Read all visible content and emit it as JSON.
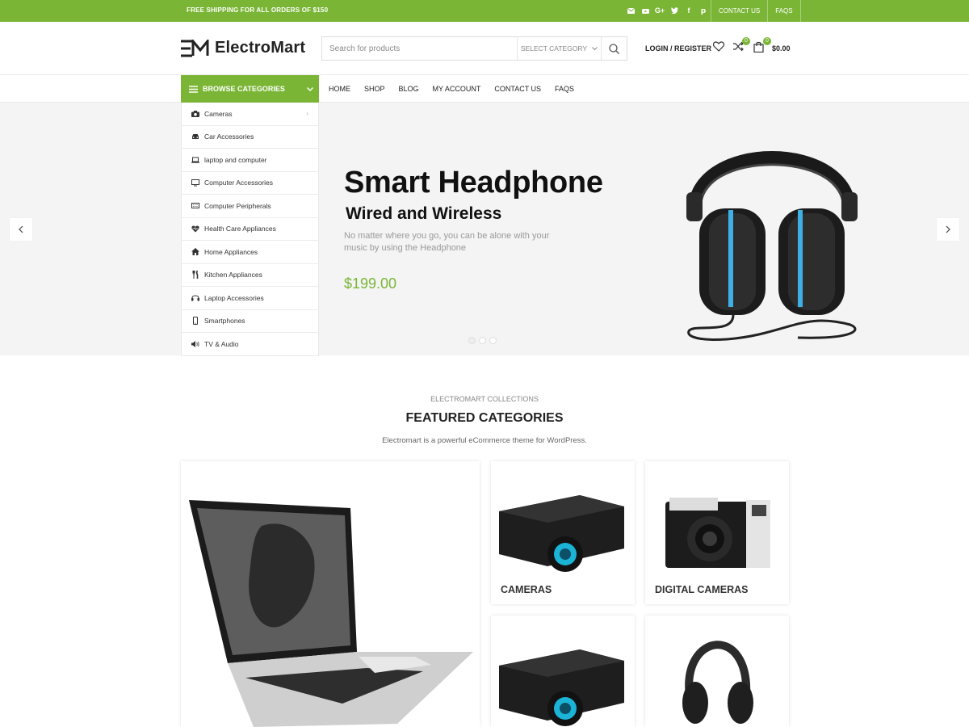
{
  "topbar": {
    "shipping_text": "FREE SHIPPING FOR ALL ORDERS OF $150",
    "links": [
      "CONTACT US",
      "FAQS"
    ],
    "social_icons": [
      "mail-icon",
      "youtube-icon",
      "google-plus-icon",
      "twitter-icon",
      "facebook-icon",
      "pinterest-icon"
    ]
  },
  "header": {
    "logo_text": "ElectroMart",
    "search_placeholder": "Search for products",
    "category_select": "SELECT CATEGORY",
    "login": "LOGIN / REGISTER",
    "compare_count": "0",
    "cart_count": "0",
    "cart_total": "$0.00"
  },
  "nav": {
    "browse_label": "BROWSE CATEGORIES",
    "menu": [
      "HOME",
      "SHOP",
      "BLOG",
      "MY ACCOUNT",
      "CONTACT US",
      "FAQS"
    ]
  },
  "categories": [
    {
      "label": "Cameras",
      "icon": "camera-icon"
    },
    {
      "label": "Car Accessories",
      "icon": "car-icon"
    },
    {
      "label": "laptop and computer",
      "icon": "laptop-icon"
    },
    {
      "label": "Computer Accessories",
      "icon": "monitor-icon"
    },
    {
      "label": "Computer Peripherals",
      "icon": "keyboard-icon"
    },
    {
      "label": "Health Care Appliances",
      "icon": "heartbeat-icon"
    },
    {
      "label": "Home Appliances",
      "icon": "home-icon"
    },
    {
      "label": "Kitchen Appliances",
      "icon": "utensils-icon"
    },
    {
      "label": "Laptop Accessories",
      "icon": "headset-icon"
    },
    {
      "label": "Smartphones",
      "icon": "mobile-icon"
    },
    {
      "label": "TV & Audio",
      "icon": "speaker-icon"
    }
  ],
  "hero": {
    "title": "Smart Headphone",
    "subtitle": "Wired and Wireless",
    "description": "No matter where you go, you can be alone with your music by using the Headphone",
    "price": "$199.00"
  },
  "featured": {
    "eyebrow": "ELECTROMART COLLECTIONS",
    "title": "FEATURED CATEGORIES",
    "description": "Electromart is a powerful eCommerce theme for WordPress.",
    "cards": [
      "CAMERAS",
      "DIGITAL CAMERAS"
    ]
  },
  "colors": {
    "accent": "#7ab536",
    "text": "#222222",
    "hero_bg": "#f4f4f4"
  }
}
